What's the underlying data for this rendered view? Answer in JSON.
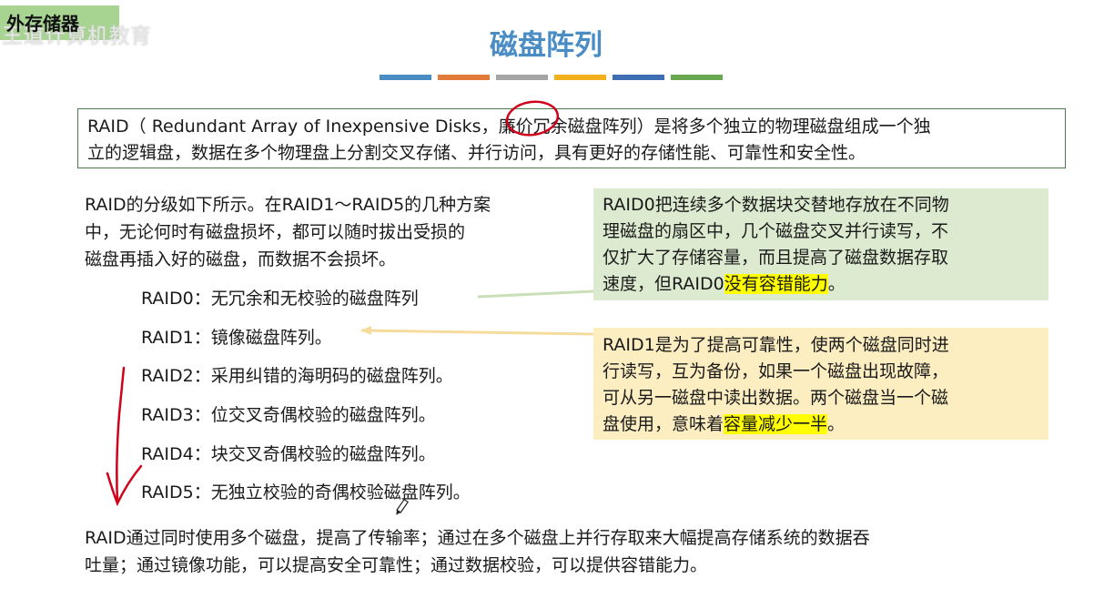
{
  "header": {
    "section_tag": "外存储器",
    "watermark": "王道计算机教育",
    "title": "磁盘阵列",
    "stripe_colors": [
      "#4a8cc4",
      "#e07b39",
      "#a5a5a5",
      "#f2b01e",
      "#3f6fb3",
      "#6aa84f"
    ]
  },
  "intro": {
    "line1": "RAID（ Redundant Array of Inexpensive Disks，廉价冗余磁盘阵列）是将多个独立的物理磁盘组成一个独",
    "line2": "立的逻辑盘，数据在多个物理盘上分割交叉存储、并行访问，具有更好的存储性能、可靠性和安全性。"
  },
  "levels": {
    "line1": "RAID的分级如下所示。在RAID1～RAID5的几种方案",
    "line2": "中，无论何时有磁盘损坏，都可以随时拔出受损的",
    "line3": "磁盘再插入好的磁盘，而数据不会损坏。",
    "items": [
      "RAID0：无冗余和无校验的磁盘阵列",
      "RAID1：镜像磁盘阵列。",
      "RAID2：采用纠错的海明码的磁盘阵列。",
      "RAID3：位交叉奇偶校验的磁盘阵列。",
      "RAID4：块交叉奇偶校验的磁盘阵列。",
      "RAID5：无独立校验的奇偶校验磁盘阵列。"
    ]
  },
  "raid0_note": {
    "line1": "RAID0把连续多个数据块交替地存放在不同物",
    "line2": "理磁盘的扇区中，几个磁盘交叉并行读写，不",
    "line3": "仅扩大了存储容量，而且提高了磁盘数据存取",
    "line4_prefix": "速度，但RAID0",
    "line4_highlight": "没有容错能力",
    "line4_suffix": "。"
  },
  "raid1_note": {
    "line1": "RAID1是为了提高可靠性，使两个磁盘同时进",
    "line2": "行读写，互为备份，如果一个磁盘出现故障，",
    "line3": "可从另一磁盘中读出数据。两个磁盘当一个磁",
    "line4_prefix": "盘使用，意味着",
    "line4_highlight": "容量减少一半",
    "line4_suffix": "。"
  },
  "summary": {
    "line1": "RAID通过同时使用多个磁盘，提高了传输率；通过在多个磁盘上并行存取来大幅提高存储系统的数据吞",
    "line2": "吐量；通过镜像功能，可以提高安全可靠性；通过数据校验，可以提供容错能力。"
  }
}
